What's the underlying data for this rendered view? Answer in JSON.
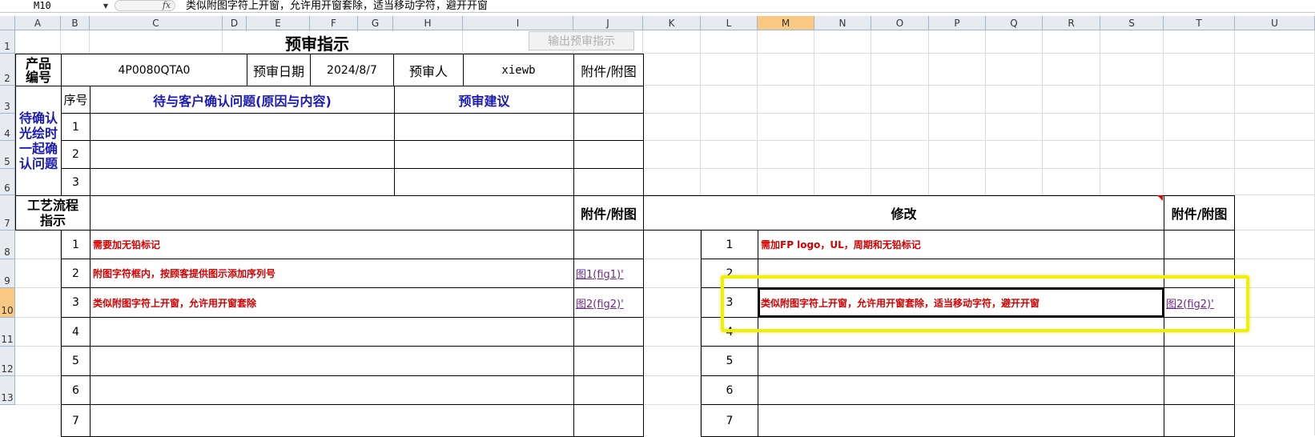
{
  "formula_bar": {
    "name_box": "M10",
    "fx_label": "fx",
    "formula": "类似附图字符上开窗，允许用开窗套除，适当移动字符，避开开窗"
  },
  "columns": [
    "A",
    "B",
    "C",
    "D",
    "E",
    "F",
    "G",
    "H",
    "I",
    "J",
    "K",
    "L",
    "M",
    "N",
    "O",
    "P",
    "Q",
    "R",
    "S",
    "T",
    "U"
  ],
  "rows": [
    "1",
    "2",
    "3",
    "4",
    "5",
    "6",
    "7",
    "8",
    "9",
    "10",
    "11",
    "12",
    "13"
  ],
  "sheet": {
    "title": "预审指示",
    "export_button": "输出预审指示",
    "product_no_label": "产品\n编号",
    "product_no": "4P0080QTA0",
    "review_date_label": "预审日期",
    "review_date": "2024/8/7",
    "reviewer_label": "预审人",
    "reviewer": "xiewb",
    "attachment_label": "附件/附图",
    "pending_label": "待确认\n光绘时\n一起确\n认问题",
    "seq_label": "序号",
    "issue_header": "待与客户确认问题(原因与内容)",
    "suggestion_header": "预审建议",
    "pending_rows": [
      "1",
      "2",
      "3"
    ],
    "process_label": "工艺流程\n指示",
    "modify_header": "修改",
    "left_items": [
      {
        "no": "1",
        "text": "需要加无铅标记",
        "link": ""
      },
      {
        "no": "2",
        "text": "附图字符框内，按顾客提供图示添加序列号",
        "link": "图1(fig1)'"
      },
      {
        "no": "3",
        "text": "类似附图字符上开窗，允许用开窗套除",
        "link": "图2(fig2)'"
      },
      {
        "no": "4",
        "text": "",
        "link": ""
      },
      {
        "no": "5",
        "text": "",
        "link": ""
      },
      {
        "no": "6",
        "text": "",
        "link": ""
      },
      {
        "no": "7",
        "text": "",
        "link": ""
      }
    ],
    "right_items": [
      {
        "no": "1",
        "text": "需加FP logo，UL，周期和无铅标记",
        "link": ""
      },
      {
        "no": "2",
        "text": "",
        "link": ""
      },
      {
        "no": "3",
        "text": "类似附图字符上开窗，允许用开窗套除，适当移动字符，避开开窗",
        "link": "图2(fig2)'"
      },
      {
        "no": "4",
        "text": "",
        "link": ""
      },
      {
        "no": "5",
        "text": "",
        "link": ""
      },
      {
        "no": "6",
        "text": "",
        "link": ""
      },
      {
        "no": "7",
        "text": "",
        "link": ""
      }
    ]
  },
  "colors": {
    "highlight": "#f0f000",
    "header_bg": "#e7ebf0",
    "selected_header": "#f9c983",
    "red_text": "#d60000",
    "blue_text": "#1a1ab8"
  }
}
